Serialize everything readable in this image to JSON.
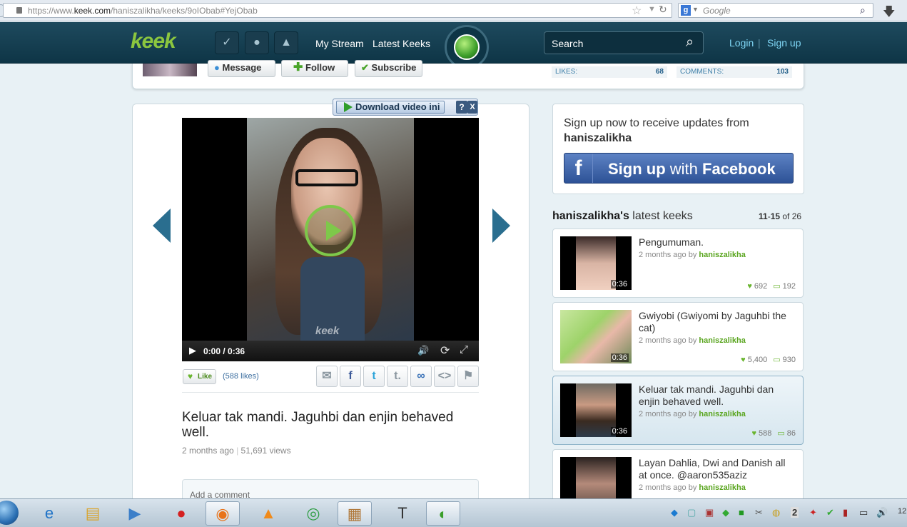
{
  "browser": {
    "url_prefix": "https://www.",
    "url_domain": "keek.com",
    "url_path": "/haniszalikha/keeks/9oIObab#YejObab",
    "search_placeholder": "Google"
  },
  "nav": {
    "logo": "keek",
    "my_stream": "My Stream",
    "latest_keeks": "Latest Keeks",
    "search_placeholder": "Search",
    "login": "Login",
    "separator": "|",
    "signup": "Sign up"
  },
  "profile": {
    "message": "Message",
    "follow": "Follow",
    "subscribe": "Subscribe",
    "likes_label": "LIKES:",
    "likes_value": "68",
    "comments_label": "COMMENTS:",
    "comments_value": "103"
  },
  "download_bar": {
    "label": "Download video ini",
    "help": "?",
    "close": "X"
  },
  "video": {
    "time": "0:00 / 0:36",
    "watermark": "keek"
  },
  "actions": {
    "like": "Like",
    "likes_count": "(588 likes)"
  },
  "post": {
    "title": "Keluar tak mandi. Jaguhbi dan enjin behaved well.",
    "posted": "2 months ago",
    "separator": "|",
    "views": "51,691 views"
  },
  "comment": {
    "placeholder": "Add a comment"
  },
  "signup_panel": {
    "prompt": "Sign up now to receive updates from",
    "username": "haniszalikha",
    "fb_letter": "f",
    "fb_bold1": "Sign up",
    "fb_mid": " with ",
    "fb_bold2": "Facebook"
  },
  "latest": {
    "user": "haniszalikha's",
    "heading": " latest keeks",
    "range_a": "11",
    "range_dash": "-",
    "range_b": "15",
    "range_of": " of ",
    "total": "26"
  },
  "cards": [
    {
      "title": "Pengumuman.",
      "ago": "2 months ago by ",
      "user": "haniszalikha",
      "likes": "692",
      "comments": "192",
      "duration": "0:36"
    },
    {
      "title": "Gwiyobi (Gwiyomi by Jaguhbi the cat)",
      "ago": "2 months ago by ",
      "user": "haniszalikha",
      "likes": "5,400",
      "comments": "930",
      "duration": "0:36"
    },
    {
      "title": "Keluar tak mandi. Jaguhbi dan enjin behaved well.",
      "ago": "2 months ago by ",
      "user": "haniszalikha",
      "likes": "588",
      "comments": "86",
      "duration": "0:36"
    },
    {
      "title": "Layan Dahlia, Dwi and Danish all at once. @aaron535aziz",
      "ago": "2 months ago by ",
      "user": "haniszalikha",
      "likes": "",
      "comments": "",
      "duration": ""
    }
  ],
  "taskbar": {
    "tray_num": "2",
    "clock": "12"
  },
  "colors": {
    "nav_bg": "#0e3546",
    "accent_green": "#8bc63f",
    "link_blue": "#7fd6f5",
    "facebook_blue": "#3b5998"
  }
}
